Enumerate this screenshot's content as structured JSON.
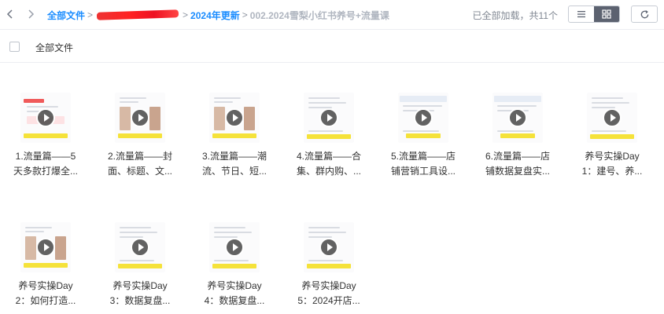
{
  "breadcrumb": {
    "root": "全部文件",
    "level2": "2024年更新",
    "current": "002.2024雪梨小红书养号+流量课"
  },
  "status": {
    "text": "已全部加载，共11个"
  },
  "select_all": {
    "label": "全部文件"
  },
  "icons": {
    "back": "chevron-left-icon",
    "forward": "chevron-right-icon",
    "list_view": "list-view-icon",
    "grid_view": "grid-view-icon",
    "refresh": "refresh-icon",
    "play": "play-icon"
  },
  "colors": {
    "link": "#1a8cff",
    "redaction": "#ee2222",
    "active_view": "#5c6270",
    "caption_yellow": "#f5e23a"
  },
  "files": [
    {
      "line1": "1.流量篇——5",
      "line2": "天多款打爆全...",
      "thumb": "pink"
    },
    {
      "line1": "2.流量篇——封",
      "line2": "面、标题、文...",
      "thumb": "photo"
    },
    {
      "line1": "3.流量篇——潮",
      "line2": "流、节日、短...",
      "thumb": "photo"
    },
    {
      "line1": "4.流量篇——合",
      "line2": "集、群内购、...",
      "thumb": "text"
    },
    {
      "line1": "5.流量篇——店",
      "line2": "铺营销工具设...",
      "thumb": "screen"
    },
    {
      "line1": "6.流量篇——店",
      "line2": "铺数据复盘实...",
      "thumb": "screen"
    },
    {
      "line1": "养号实操Day",
      "line2": "1：建号、养...",
      "thumb": "text"
    },
    {
      "line1": "养号实操Day",
      "line2": "2：如何打造...",
      "thumb": "photo"
    },
    {
      "line1": "养号实操Day",
      "line2": "3：数据复盘...",
      "thumb": "text"
    },
    {
      "line1": "养号实操Day",
      "line2": "4：数据复盘...",
      "thumb": "text"
    },
    {
      "line1": "养号实操Day",
      "line2": "5：2024开店...",
      "thumb": "text"
    }
  ]
}
